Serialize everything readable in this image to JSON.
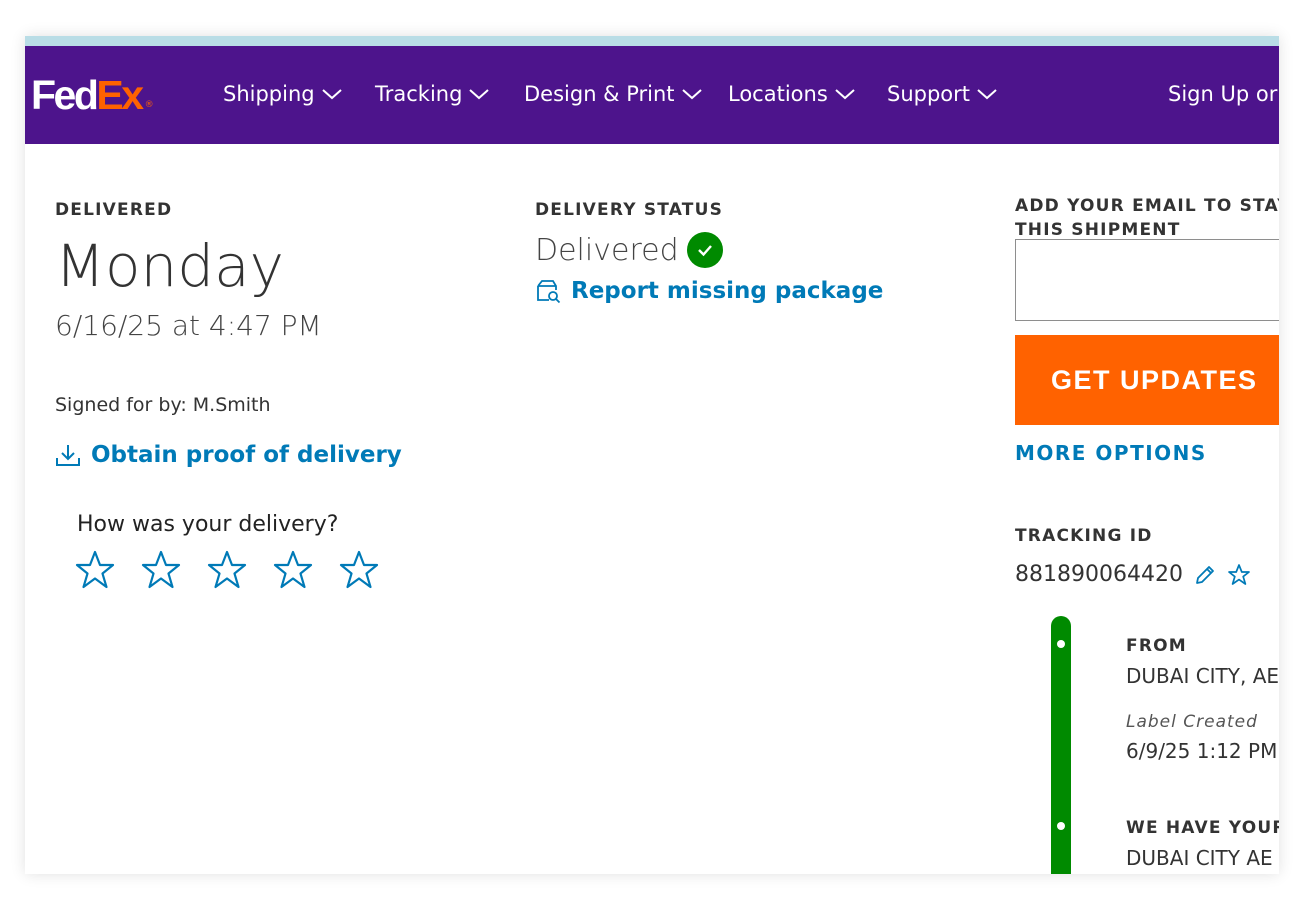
{
  "brand": {
    "name_part1": "Fed",
    "name_part2": "Ex",
    "registered": "®"
  },
  "nav": {
    "items": [
      {
        "label": "Shipping"
      },
      {
        "label": "Tracking"
      },
      {
        "label": "Design & Print"
      },
      {
        "label": "Locations"
      },
      {
        "label": "Support"
      }
    ],
    "sign_in": "Sign Up or L"
  },
  "delivery": {
    "heading": "DELIVERED",
    "day": "Monday",
    "datetime": "6/16/25 at 4:47 PM",
    "signed_for": "Signed for by: M.Smith",
    "proof_link": "Obtain proof of delivery",
    "rating_question": "How was your delivery?",
    "rating_stars": 5
  },
  "status": {
    "heading": "DELIVERY STATUS",
    "value": "Delivered",
    "report_link": "Report missing package"
  },
  "updates": {
    "email_label_line1": "ADD YOUR EMAIL TO STAY",
    "email_label_line2": "THIS SHIPMENT",
    "email_value": "",
    "button_label": "GET UPDATES",
    "more_options": "MORE OPTIONS"
  },
  "tracking": {
    "heading": "TRACKING ID",
    "number": "881890064420"
  },
  "timeline": {
    "from_heading": "FROM",
    "from_location": "DUBAI CITY, AE",
    "event1_label": "Label Created",
    "event1_time": "6/9/25 1:12 PM",
    "event2_heading": "WE HAVE YOUR",
    "event2_location": "DUBAI CITY AE"
  },
  "colors": {
    "brand_purple": "#4d148c",
    "brand_orange": "#ff6200",
    "link_blue": "#007ab7",
    "status_green": "#008a00"
  }
}
